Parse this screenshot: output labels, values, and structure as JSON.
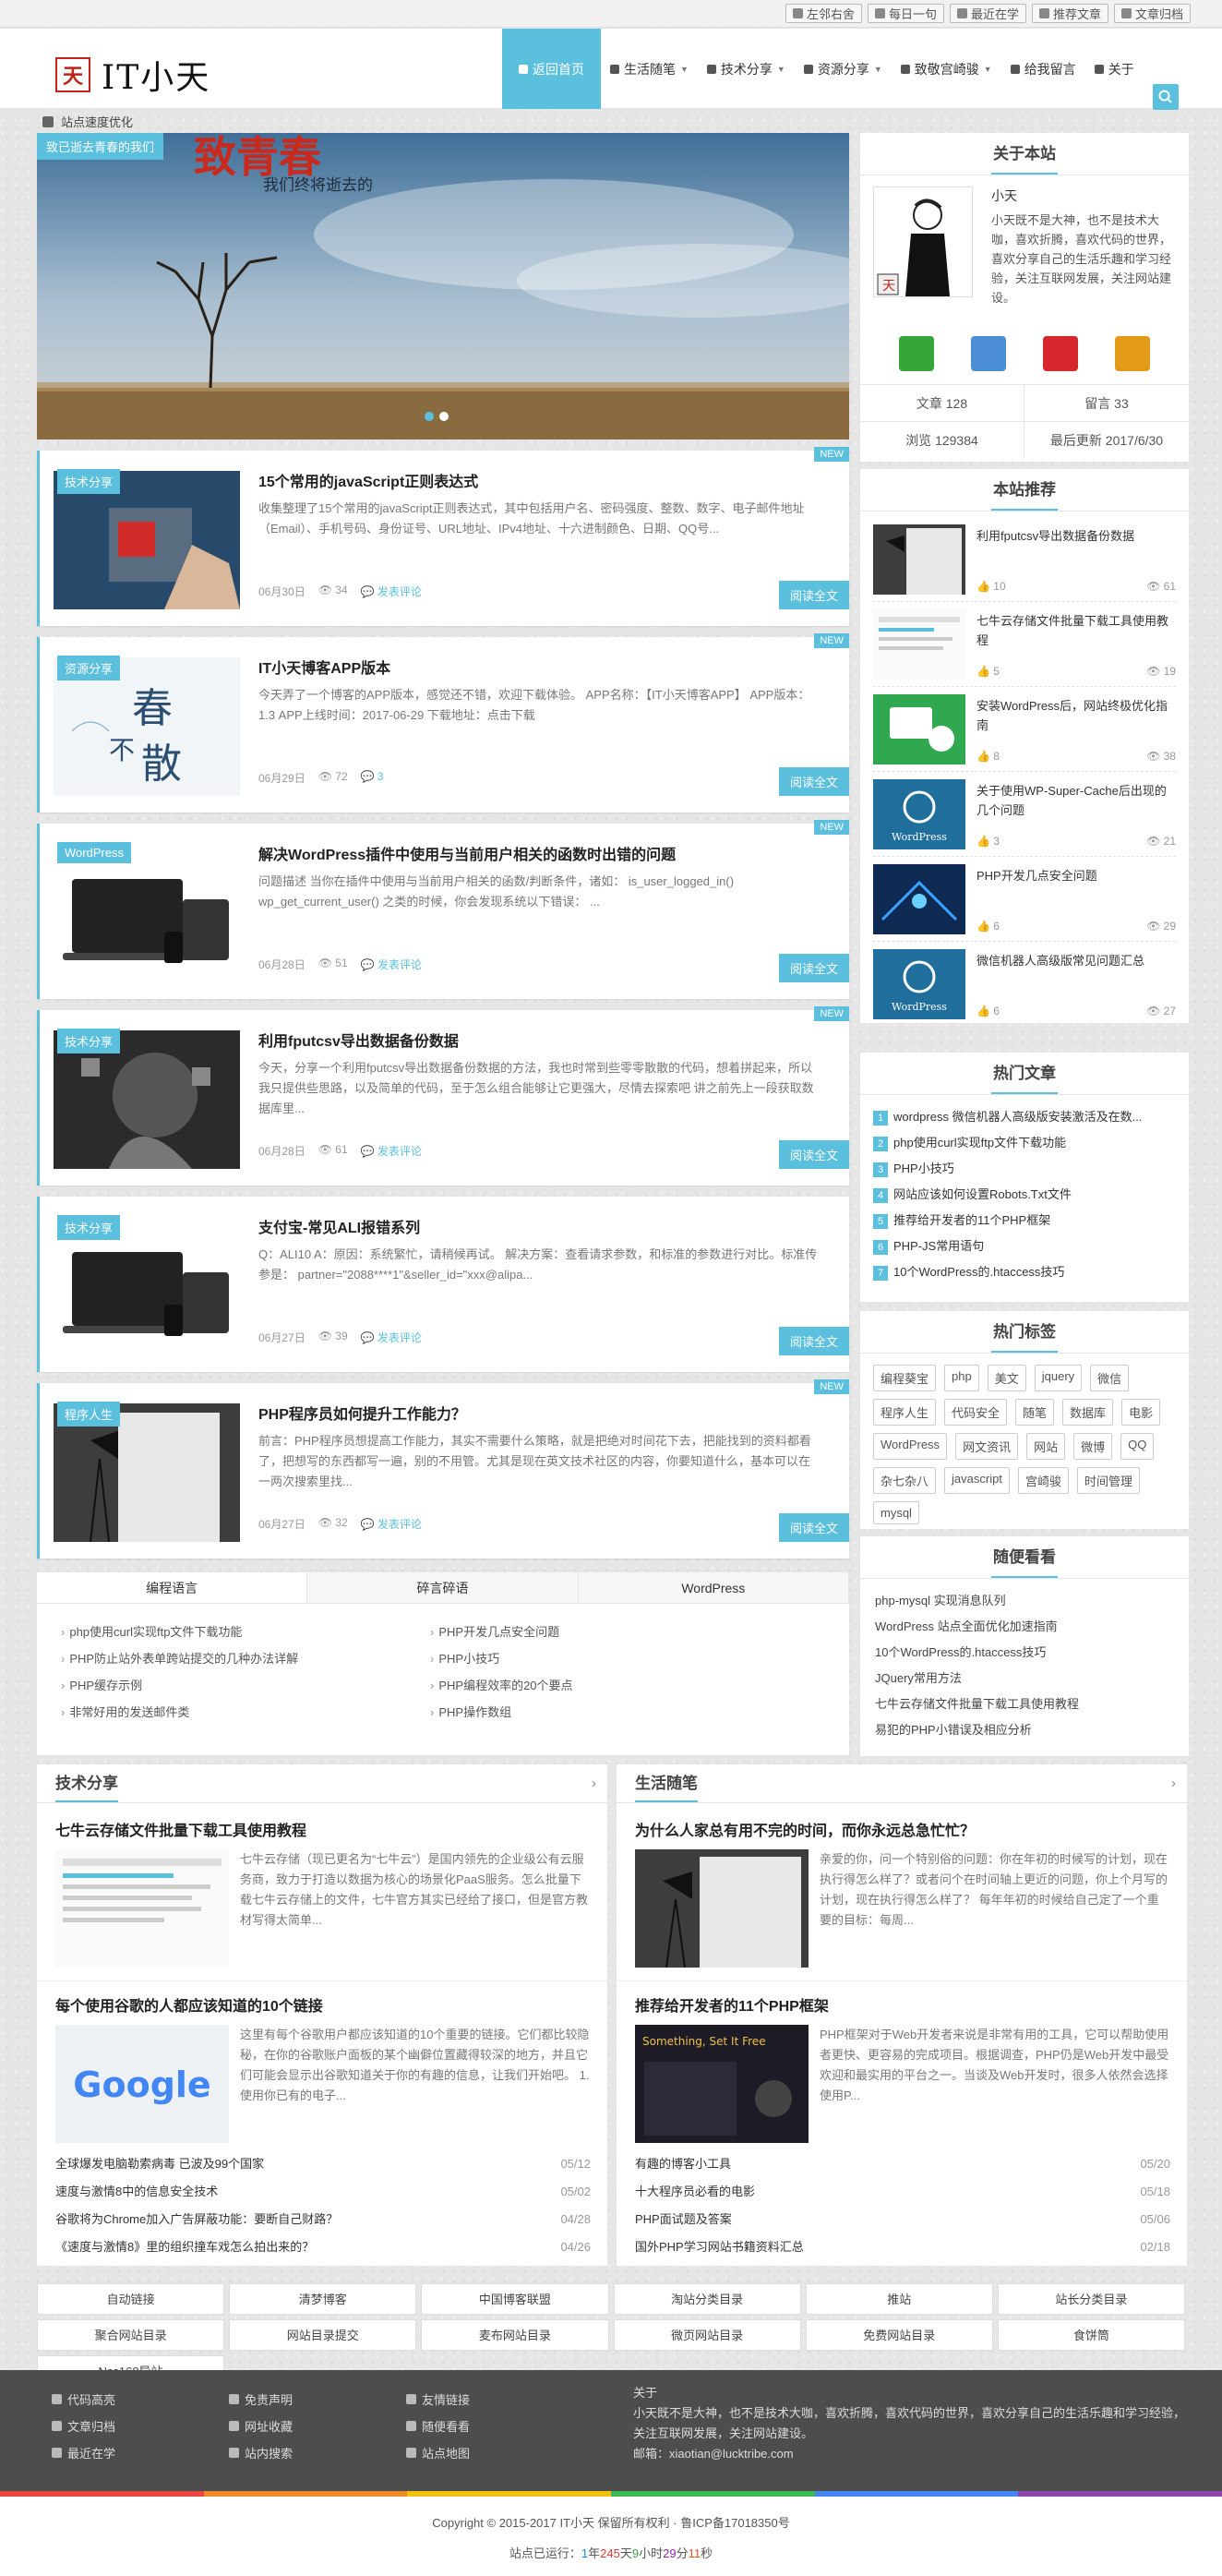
{
  "topbar": {
    "links": [
      "左邻右舍",
      "每日一句",
      "最近在学",
      "推荐文章",
      "文章归档"
    ]
  },
  "header": {
    "logo_seal": "天",
    "logo_text": "IT小天",
    "nav": [
      {
        "label": "返回首页",
        "caret": false
      },
      {
        "label": "生活随笔",
        "caret": true
      },
      {
        "label": "技术分享",
        "caret": true
      },
      {
        "label": "资源分享",
        "caret": true
      },
      {
        "label": "致敬宫崎骏",
        "caret": true
      },
      {
        "label": "给我留言",
        "caret": false
      },
      {
        "label": "关于",
        "caret": false
      }
    ]
  },
  "notice": "站点速度优化",
  "slider": {
    "caption": "致已逝去青春的我们",
    "art_title": "致青春",
    "art_subtitle": "我们终将逝去的"
  },
  "posts": [
    {
      "category": "技术分享",
      "badge": "NEW",
      "title": "15个常用的javaScript正则表达式",
      "excerpt": "收集整理了15个常用的javaScript正则表达式，其中包括用户名、密码强度、整数、数字、电子邮件地址（Email）、手机号码、身份证号、URL地址、IPv4地址、十六进制颜色、日期、QQ号...",
      "date": "06月30日",
      "views": "34",
      "comments": "发表评论",
      "more": "阅读全文"
    },
    {
      "category": "资源分享",
      "badge": "NEW",
      "title": "IT小天博客APP版本",
      "excerpt": "今天弄了一个博客的APP版本，感觉还不错，欢迎下载体验。 APP名称：【IT小天博客APP】 APP版本：1.3 APP上线时间：2017-06-29 下载地址：点击下载",
      "date": "06月29日",
      "views": "72",
      "comments": "3",
      "more": "阅读全文"
    },
    {
      "category": "WordPress",
      "badge": "NEW",
      "title": "解决WordPress插件中使用与当前用户相关的函数时出错的问题",
      "excerpt": "问题描述 当你在插件中使用与当前用户相关的函数/判断条件，诸如： is_user_logged_in() wp_get_current_user() 之类的时候，你会发现系统以下错误： ...",
      "date": "06月28日",
      "views": "51",
      "comments": "发表评论",
      "more": "阅读全文"
    },
    {
      "category": "技术分享",
      "badge": "NEW",
      "title": "利用fputcsv导出数据备份数据",
      "excerpt": "今天，分享一个利用fputcsv导出数据备份数据的方法，我也时常到些零零散散的代码，想着拼起来，所以我只提供些思路，以及简单的代码，至于怎么组合能够让它更强大，尽情去探索吧 讲之前先上一段获取数据库里...",
      "date": "06月28日",
      "views": "61",
      "comments": "发表评论",
      "more": "阅读全文"
    },
    {
      "category": "技术分享",
      "badge": "NEW",
      "title": "支付宝-常见ALI报错系列",
      "excerpt": "Q：ALI10 A：原因：系统繁忙，请稍候再试。 解决方案：查看请求参数，和标准的参数进行对比。标准传参是： partner=\"2088****1\"&seller_id=\"xxx@alipa...",
      "date": "06月27日",
      "views": "39",
      "comments": "发表评论",
      "more": "阅读全文"
    },
    {
      "category": "程序人生",
      "badge": "NEW",
      "title": "PHP程序员如何提升工作能力？",
      "excerpt": "前言：PHP程序员想提高工作能力，其实不需要什么策略，就是把绝对时间花下去，把能找到的资料都看了，把想写的东西都写一遍，别的不用管。尤其是现在英文技术社区的内容，你要知道什么，基本可以在一两次搜索里找...",
      "date": "06月27日",
      "views": "32",
      "comments": "发表评论",
      "more": "阅读全文"
    }
  ],
  "tabs": {
    "labels": [
      "编程语言",
      "碎言碎语",
      "WordPress"
    ],
    "left": [
      "php使用curl实现ftp文件下载功能",
      "PHP防止站外表单跨站提交的几种办法详解",
      "PHP缓存示例",
      "非常好用的发送邮件类"
    ],
    "right": [
      "PHP开发几点安全问题",
      "PHP小技巧",
      "PHP编程效率的20个要点",
      "PHP操作数组"
    ]
  },
  "about": {
    "title": "关于本站",
    "name": "小天",
    "desc": "小天既不是大神，也不是技术大咖，喜欢折腾，喜欢代码的世界，喜欢分享自己的生活乐趣和学习经验，关注互联网发展，关注网站建设。",
    "stats": [
      "文章 128",
      "留言 33",
      "浏览 129384",
      "最后更新 2017/6/30"
    ],
    "social_colors": [
      "#35a63a",
      "#4b8ed6",
      "#d6262e",
      "#e39a16"
    ]
  },
  "recommend": {
    "title": "本站推荐",
    "items": [
      {
        "title": "利用fputcsv导出数据备份数据",
        "likes": "10",
        "views": "61"
      },
      {
        "title": "七牛云存储文件批量下载工具使用教程",
        "likes": "5",
        "views": "19"
      },
      {
        "title": "安装WordPress后，网站终极优化指南",
        "likes": "8",
        "views": "38"
      },
      {
        "title": "关于使用WP-Super-Cache后出现的几个问题",
        "likes": "3",
        "views": "21"
      },
      {
        "title": "PHP开发几点安全问题",
        "likes": "6",
        "views": "29"
      },
      {
        "title": "微信机器人高级版常见问题汇总",
        "likes": "6",
        "views": "27"
      }
    ],
    "wp_label": "WordPress"
  },
  "hot": {
    "title": "热门文章",
    "items": [
      "wordpress 微信机器人高级版安装激活及在数...",
      "php使用curl实现ftp文件下载功能",
      "PHP小技巧",
      "网站应该如何设置Robots.Txt文件",
      "推荐给开发者的11个PHP框架",
      "PHP-JS常用语句",
      "10个WordPress的.htaccess技巧"
    ]
  },
  "tags": {
    "title": "热门标签",
    "items": [
      "编程葵宝",
      "php",
      "美文",
      "jquery",
      "微信",
      "程序人生",
      "代码安全",
      "随笔",
      "数据库",
      "电影",
      "WordPress",
      "网文资讯",
      "网站",
      "微博",
      "QQ",
      "杂七杂八",
      "javascript",
      "宫崎骏",
      "时间管理",
      "mysql"
    ]
  },
  "random": {
    "title": "随便看看",
    "items": [
      "php-mysql 实现消息队列",
      "WordPress 站点全面优化加速指南",
      "10个WordPress的.htaccess技巧",
      "JQuery常用方法",
      "七牛云存储文件批量下载工具使用教程",
      "易犯的PHP小错误及相应分析"
    ]
  },
  "tech_box": {
    "title": "技术分享",
    "first": {
      "title": "七牛云存储文件批量下载工具使用教程",
      "excerpt": "七牛云存储（现已更名为“七牛云”）是国内领先的企业级公有云服务商，致力于打造以数据为核心的场景化PaaS服务。怎么批量下载七牛云存储上的文件，七牛官方其实已经给了接口，但是官方教材写得太简单..."
    },
    "second": {
      "title": "每个使用谷歌的人都应该知道的10个链接",
      "excerpt": "这里有每个谷歌用户都应该知道的10个重要的链接。它们都比较隐秘，在你的谷歌账户面板的某个幽僻位置藏得较深的地方，并且它们可能会显示出谷歌知道关于你的有趣的信息，让我们开始吧。 1.使用你已有的电子...",
      "image_text": "Google"
    },
    "list": [
      {
        "t": "全球爆发电脑勒索病毒 已波及99个国家",
        "d": "05/12"
      },
      {
        "t": "速度与激情8中的信息安全技术",
        "d": "05/02"
      },
      {
        "t": "谷歌将为Chrome加入广告屏蔽功能：要断自己财路？",
        "d": "04/28"
      },
      {
        "t": "《速度与激情8》里的组织撞车戏怎么拍出来的？",
        "d": "04/26"
      }
    ]
  },
  "life_box": {
    "title": "生活随笔",
    "first": {
      "title": "为什么人家总有用不完的时间，而你永远总急忙忙？",
      "excerpt": "亲爱的你，问一个特别俗的问题：你在年初的时候写的计划，现在执行得怎么样了？或者问个在时间轴上更近的问题，你上个月写的计划，现在执行得怎么样了？ 每年年初的时候给自己定了一个重要的目标：每周..."
    },
    "second": {
      "title": "推荐给开发者的11个PHP框架",
      "excerpt": "PHP框架对于Web开发者来说是非常有用的工具，它可以帮助使用者更快、更容易的完成项目。根据调查，PHP仍是Web开发中最受欢迎和最实用的平台之一。当谈及Web开发时，很多人依然会选择使用P...",
      "image_text": "Something, Set It Free"
    },
    "list": [
      {
        "t": "有趣的博客小工具",
        "d": "05/20"
      },
      {
        "t": "十大程序员必看的电影",
        "d": "05/18"
      },
      {
        "t": "PHP面试题及答案",
        "d": "05/06"
      },
      {
        "t": "国外PHP学习网站书籍资料汇总",
        "d": "02/18"
      }
    ]
  },
  "links": [
    "自动链接",
    "清梦博客",
    "中国博客联盟",
    "淘站分类目录",
    "推站",
    "站长分类目录",
    "聚合网站目录",
    "网站目录提交",
    "麦布网站目录",
    "微页网站目录",
    "免费网站目录",
    "食饼筒",
    "Nss168导站"
  ],
  "footer": {
    "col1": [
      "代码高亮",
      "文章归档",
      "最近在学"
    ],
    "col2": [
      "免责声明",
      "网址收藏",
      "站内搜索"
    ],
    "col3": [
      "友情链接",
      "随便看看",
      "站点地图"
    ],
    "about_title": "关于",
    "about_text": "小天既不是大神，也不是技术大咖，喜欢折腾，喜欢代码的世界，喜欢分享自己的生活乐趣和学习经验，关注互联网发展，关注网站建设。",
    "email": "邮箱：xiaotian@lucktribe.com",
    "rainbow": [
      "#e8463f",
      "#f08a24",
      "#f4c20d",
      "#3cba54",
      "#4285f4",
      "#8e44ad"
    ]
  },
  "copyright": "Copyright © 2015-2017 IT小天 保留所有权利 · 鲁ICP备17018350号",
  "runtime": {
    "prefix": "站点已运行：",
    "years": "1",
    "y_unit": "年",
    "days": "245",
    "d_unit": "天",
    "hours": "9",
    "h_unit": "小时",
    "minutes": "29",
    "m_unit": "分",
    "seconds": "11",
    "s_unit": "秒"
  }
}
